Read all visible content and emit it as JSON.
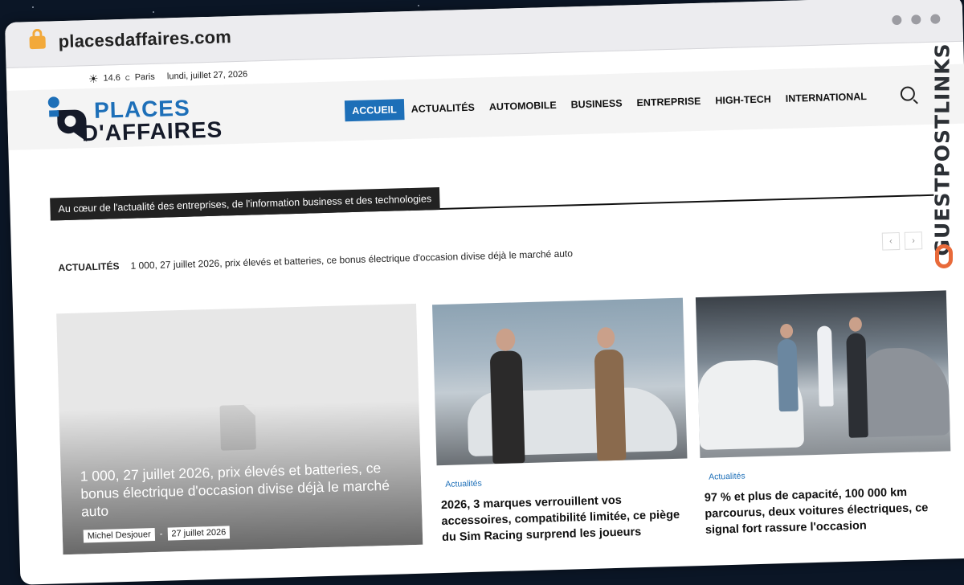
{
  "browser": {
    "url": "placesdaffaires.com"
  },
  "topbar": {
    "temperature": "14.6",
    "degree": "C",
    "city": "Paris",
    "date": "lundi, juillet 27, 2026"
  },
  "logo": {
    "line1": "PLACES",
    "line2": "D'AFFAIRES"
  },
  "nav": {
    "items": [
      "ACCUEIL",
      "ACTUALITÉS",
      "AUTOMOBILE",
      "BUSINESS",
      "ENTREPRISE",
      "HIGH-TECH",
      "INTERNATIONAL"
    ],
    "active_index": 0
  },
  "tagline": "Au cœur de l'actualité des entreprises, de l'information business et des technologies",
  "ticker": {
    "label": "ACTUALITÉS",
    "headline": "1 000, 27 juillet 2026, prix élevés et batteries, ce bonus électrique d'occasion divise déjà le marché auto"
  },
  "featured": {
    "title": "1 000, 27 juillet 2026, prix élevés et batteries, ce bonus électrique d'occasion divise déjà le marché auto",
    "author": "Michel Desjouer",
    "date": "27 juillet 2026"
  },
  "articles": [
    {
      "category": "Actualités",
      "title": "2026, 3 marques verrouillent vos accessoires, compatibilité limitée, ce piège du Sim Racing surprend les joueurs"
    },
    {
      "category": "Actualités",
      "title": "97 % et plus de capacité, 100 000 km parcourus, deux voitures électriques, ce signal fort rassure l'occasion"
    }
  ],
  "watermark": "GUESTPOSTLINKS",
  "colors": {
    "accent": "#1d6fb8",
    "watermark_logo": "#e86a3a"
  }
}
